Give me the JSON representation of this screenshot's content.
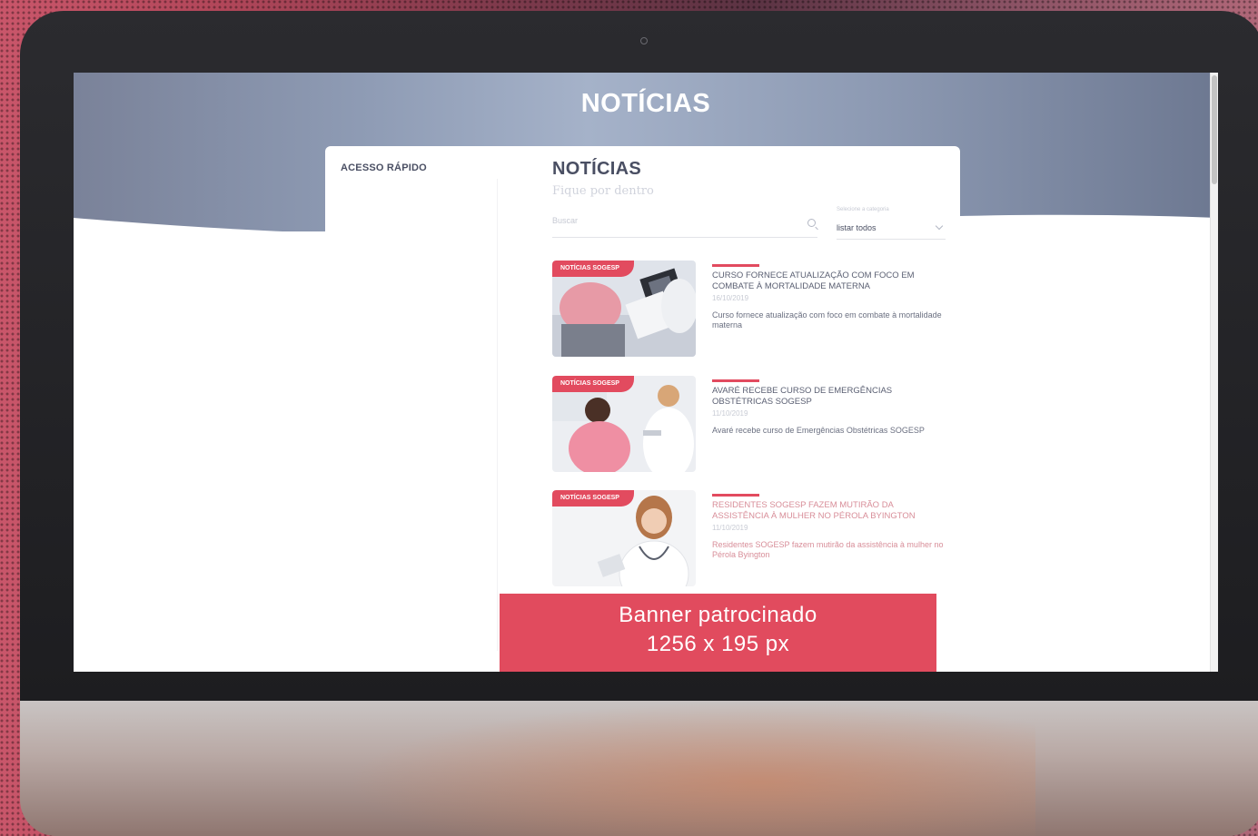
{
  "hero": {
    "title": "NOTÍCIAS"
  },
  "sidebar": {
    "quick_access_label": "ACESSO RÁPIDO"
  },
  "main": {
    "title": "NOTÍCIAS",
    "subtitle": "Fique por dentro",
    "search": {
      "placeholder": "Buscar",
      "value": ""
    },
    "category": {
      "label": "Selecione a categoria",
      "selected": "listar todos"
    },
    "news": [
      {
        "tag": "NOTÍCIAS SOGESP",
        "title": "CURSO FORNECE ATUALIZAÇÃO COM FOCO EM COMBATE À MORTALIDADE MATERNA",
        "date": "16/10/2019",
        "description": "Curso fornece atualização com foco em combate à mortalidade materna"
      },
      {
        "tag": "NOTÍCIAS SOGESP",
        "title": "AVARÉ RECEBE CURSO DE EMERGÊNCIAS OBSTÉTRICAS SOGESP",
        "date": "11/10/2019",
        "description": "Avaré recebe curso de Emergências Obstétricas SOGESP"
      },
      {
        "tag": "NOTÍCIAS SOGESP",
        "title": "RESIDENTES SOGESP FAZEM MUTIRÃO DA ASSISTÊNCIA À MULHER NO PÉROLA BYINGTON",
        "date": "11/10/2019",
        "description": "Residentes SOGESP fazem mutirão da assistência à mulher no Pérola Byington"
      }
    ]
  },
  "banner": {
    "line1": "Banner patrocinado",
    "line2": "1256 x 195 px"
  },
  "colors": {
    "accent": "#e24b5f",
    "text_dark": "#4a4f63"
  }
}
